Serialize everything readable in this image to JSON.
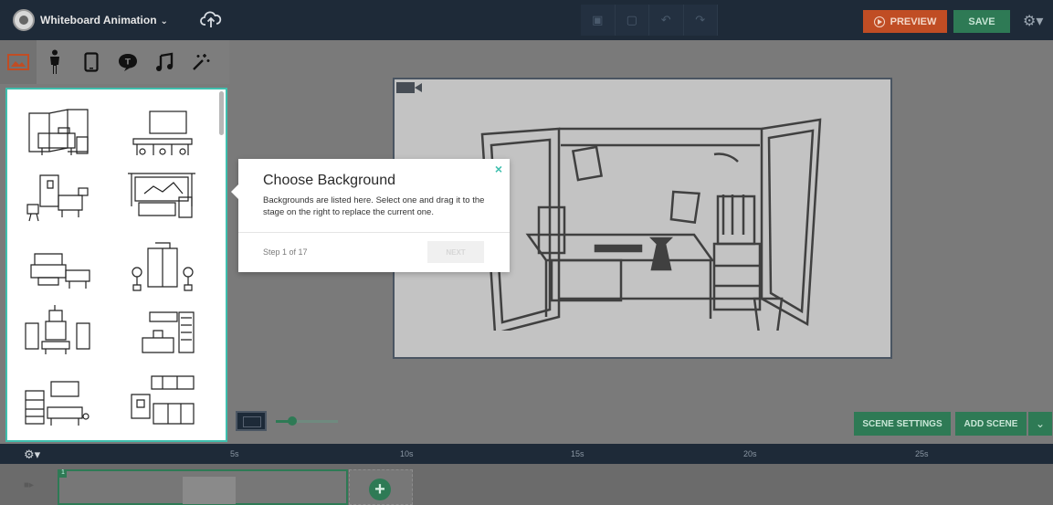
{
  "topbar": {
    "project_title": "Whiteboard Animation",
    "title_chevron": "⌄",
    "preview_label": "PREVIEW",
    "save_label": "SAVE",
    "settings_glyph": "⚙▾",
    "arrange_icons": [
      "bring-forward-icon",
      "send-backward-icon",
      "undo-icon",
      "redo-icon"
    ],
    "arrange_glyphs": [
      "▣",
      "▢",
      "↶",
      "↷"
    ]
  },
  "tabs": [
    {
      "name": "tab-backgrounds",
      "glyph": "🖼",
      "active": true
    },
    {
      "name": "tab-characters",
      "glyph": "🕴",
      "active": false
    },
    {
      "name": "tab-props",
      "glyph": "▯",
      "active": false
    },
    {
      "name": "tab-text",
      "glyph": "💬",
      "active": false
    },
    {
      "name": "tab-music",
      "glyph": "♫",
      "active": false
    },
    {
      "name": "tab-effects",
      "glyph": "✴",
      "active": false
    }
  ],
  "tour": {
    "title": "Choose Background",
    "body": "Backgrounds are listed here. Select one and drag it to the stage on the right to replace the current one.",
    "step": "Step 1 of 17",
    "next_label": "NEXT",
    "close_glyph": "×"
  },
  "stage_controls": {
    "scene_settings_label": "SCENE SETTINGS",
    "add_scene_label": "ADD SCENE",
    "add_scene_dropdown_glyph": "⌄",
    "zoom_level": 0.2
  },
  "timeline": {
    "gear_glyph": "⚙▾",
    "ticks": [
      "5s",
      "10s",
      "15s",
      "20s",
      "25s"
    ],
    "scene_number": "1",
    "add_glyph": "+",
    "track_glyph": "■▸"
  },
  "colors": {
    "accent_teal": "#3fbfae",
    "brand_green": "#2e7a55",
    "preview_orange": "#c04d24",
    "topbar_navy": "#1e2a38"
  }
}
